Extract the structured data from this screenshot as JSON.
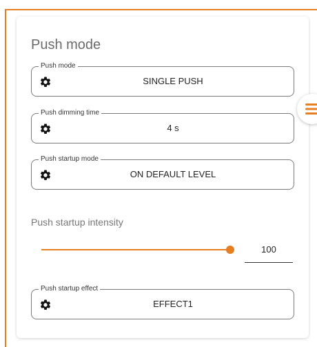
{
  "panel": {
    "title": "Push mode",
    "fields": [
      {
        "legend": "Push mode",
        "value": "SINGLE PUSH",
        "icon": "gear-icon"
      },
      {
        "legend": "Push dimming time",
        "value": "4 s",
        "icon": "gear-icon"
      },
      {
        "legend": "Push startup mode",
        "value": "ON DEFAULT LEVEL",
        "icon": "gear-icon"
      }
    ],
    "intensity": {
      "label": "Push startup intensity",
      "value": "100",
      "level": 1.0
    },
    "effect_field": {
      "legend": "Push startup effect",
      "value": "EFFECT1",
      "icon": "gear-icon"
    }
  },
  "side_menu": {
    "icon": "menu-icon"
  },
  "colors": {
    "accent": "#e67e22",
    "border": "#7a7a7a",
    "text": "#333333"
  }
}
